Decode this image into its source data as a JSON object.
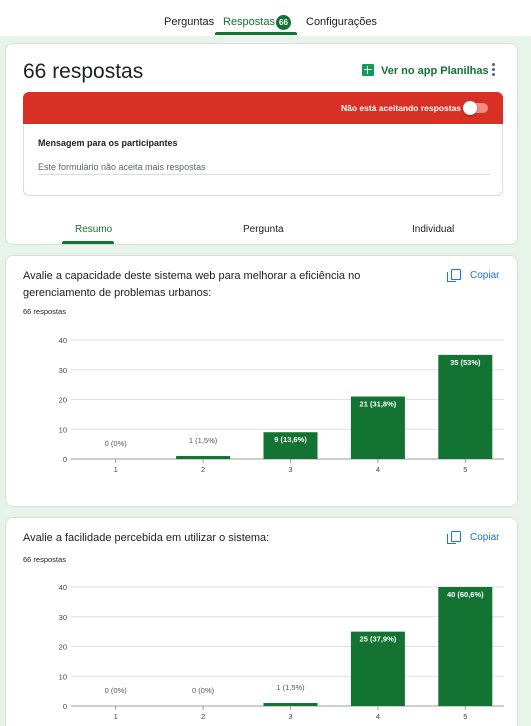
{
  "nav": {
    "tabs": [
      {
        "label": "Perguntas"
      },
      {
        "label": "Respostas"
      },
      {
        "label": "Configurações"
      }
    ],
    "responses_badge": "66"
  },
  "header": {
    "title": "66 respostas",
    "sheets_link": "Ver no app Planilhas",
    "menu_icon": "more-vert-icon",
    "sheets_icon": "sheets-icon"
  },
  "status": {
    "not_accepting": "Não está aceitando respostas",
    "accepting_responses": false
  },
  "message": {
    "label": "Mensagem para os participantes",
    "value": "Este formulário não aceita mais respostas"
  },
  "subtabs": [
    {
      "label": "Resumo"
    },
    {
      "label": "Pergunta"
    },
    {
      "label": "Individual"
    }
  ],
  "questions": [
    {
      "title": "Avalie a capacidade deste sistema web para melhorar a eficiência no gerenciamento de problemas urbanos:",
      "count": "66 respostas",
      "copy": "Copiar"
    },
    {
      "title": "Avalie a facilidade percebida em utilizar o sistema:",
      "count": "66 respostas",
      "copy": "Copiar"
    }
  ],
  "colors": {
    "accent": "#137333",
    "danger": "#d93025",
    "link": "#1a73e8",
    "bar": "#137333"
  },
  "chart_data": [
    {
      "type": "bar",
      "categories": [
        "1",
        "2",
        "3",
        "4",
        "5"
      ],
      "values": [
        0,
        1,
        9,
        21,
        35
      ],
      "labels": [
        "0 (0%)",
        "1 (1,5%)",
        "9 (13,6%)",
        "21 (31,8%)",
        "35 (53%)"
      ],
      "yticks": [
        0,
        10,
        20,
        30,
        40
      ],
      "ylim": [
        0,
        40
      ],
      "grid": true
    },
    {
      "type": "bar",
      "categories": [
        "1",
        "2",
        "3",
        "4",
        "5"
      ],
      "values": [
        0,
        0,
        1,
        25,
        40
      ],
      "labels": [
        "0 (0%)",
        "0 (0%)",
        "1 (1,5%)",
        "25 (37,9%)",
        "40 (60,6%)"
      ],
      "yticks": [
        0,
        10,
        20,
        30,
        40
      ],
      "ylim": [
        0,
        40
      ],
      "grid": true
    }
  ]
}
